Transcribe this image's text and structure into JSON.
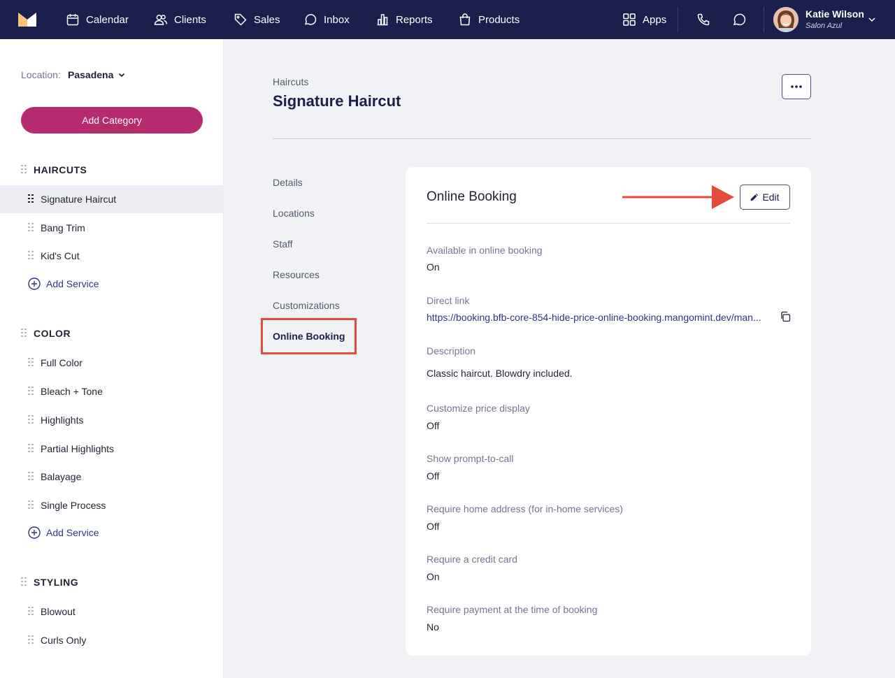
{
  "nav": {
    "items": [
      {
        "label": "Calendar",
        "icon": "calendar-icon"
      },
      {
        "label": "Clients",
        "icon": "users-icon"
      },
      {
        "label": "Sales",
        "icon": "tag-icon"
      },
      {
        "label": "Inbox",
        "icon": "chat-icon"
      },
      {
        "label": "Reports",
        "icon": "bar-chart-icon"
      },
      {
        "label": "Products",
        "icon": "shopping-bag-icon"
      }
    ],
    "apps_label": "Apps",
    "user": {
      "name": "Katie Wilson",
      "business": "Salon Azul"
    }
  },
  "sidebar": {
    "location_label": "Location:",
    "location_value": "Pasadena",
    "add_category_label": "Add Category",
    "categories": [
      {
        "name": "HAIRCUTS",
        "services": [
          "Signature Haircut",
          "Bang Trim",
          "Kid's Cut"
        ],
        "add_label": "Add Service"
      },
      {
        "name": "COLOR",
        "services": [
          "Full Color",
          "Bleach + Tone",
          "Highlights",
          "Partial Highlights",
          "Balayage",
          "Single Process"
        ],
        "add_label": "Add Service"
      },
      {
        "name": "STYLING",
        "services": [
          "Blowout",
          "Curls Only"
        ]
      }
    ]
  },
  "main": {
    "breadcrumb": "Haircuts",
    "title": "Signature Haircut",
    "subnav": [
      "Details",
      "Locations",
      "Staff",
      "Resources",
      "Customizations",
      "Online Booking"
    ],
    "card": {
      "title": "Online Booking",
      "edit_label": "Edit",
      "fields": [
        {
          "label": "Available in online booking",
          "value": "On"
        },
        {
          "label": "Direct link",
          "value": "https://booking.bfb-core-854-hide-price-online-booking.mangomint.dev/man..."
        },
        {
          "label": "Description",
          "value": "Classic haircut. Blowdry included."
        },
        {
          "label": "Customize price display",
          "value": "Off"
        },
        {
          "label": "Show prompt-to-call",
          "value": "Off"
        },
        {
          "label": "Require home address (for in-home services)",
          "value": "Off"
        },
        {
          "label": "Require a credit card",
          "value": "On"
        },
        {
          "label": "Require payment at the time of booking",
          "value": "No"
        }
      ]
    }
  },
  "colors": {
    "topbar": "#1b1f4b",
    "accent": "#b52b6d",
    "highlight": "#e54b3c",
    "link": "#2d3488"
  }
}
